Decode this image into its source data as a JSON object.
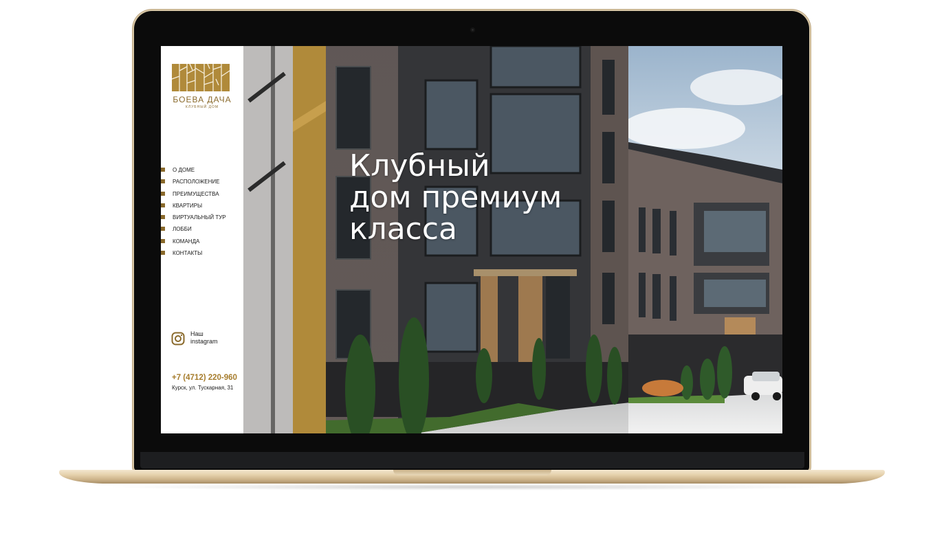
{
  "site": {
    "brand": {
      "name": "БОЕВА ДАЧА",
      "subtitle": "КЛУБНЫЙ ДОМ"
    },
    "nav": [
      {
        "label": "О ДОМЕ"
      },
      {
        "label": "РАСПОЛОЖЕНИЕ"
      },
      {
        "label": "ПРЕИМУЩЕСТВА"
      },
      {
        "label": "КВАРТИРЫ"
      },
      {
        "label": "ВИРТУАЛЬНЫЙ ТУР"
      },
      {
        "label": "ЛОББИ"
      },
      {
        "label": "КОМАНДА"
      },
      {
        "label": "КОНТАКТЫ"
      }
    ],
    "instagram": {
      "label": "Наш\ninstagram",
      "icon": "instagram-icon"
    },
    "contact": {
      "phone": "+7 (4712) 220-960",
      "address": "Курск, ул. Тускарная, 31"
    },
    "hero": {
      "title": "Клубный\nдом премиум\nкласса"
    },
    "colors": {
      "accent": "#b08a3a",
      "brand_text": "#8a6a2c",
      "phone": "#a67c2c"
    }
  }
}
